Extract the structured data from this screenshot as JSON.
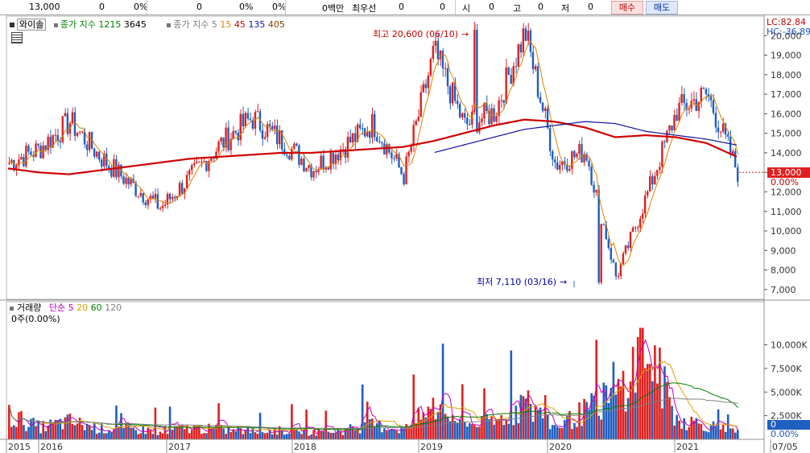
{
  "topbar": {
    "price": "13,000",
    "v1": "0",
    "pct1": "0%",
    "v2": "0",
    "pct2": "0%",
    "pct3": "0%",
    "amount": "0백만",
    "best_label": "최우선",
    "best_v1": "0",
    "best_v2": "0",
    "open_label": "시",
    "open_v": "0",
    "high_label": "고",
    "high_v": "0",
    "low_label": "저",
    "low_v": "0",
    "buy_label": "매수",
    "sell_label": "매도"
  },
  "price_panel": {
    "stock_name": "와이솔",
    "legend1_label": "종가 지수",
    "legend1_values": [
      "1215",
      "3645"
    ],
    "legend2_label": "종가 지수",
    "legend2_values": [
      "5",
      "15",
      "45",
      "135",
      "405"
    ],
    "legend2_colors": [
      "#808080",
      "#e08000",
      "#d00000",
      "#1010a0",
      "#804000"
    ],
    "lc_label": "LC:82.84",
    "hc_label": "HC:-36.89",
    "current_price": "13,000",
    "current_pct": "0.00%",
    "max_annotation": "최고 20,600 (06/10)",
    "min_annotation": "최저 7,110 (03/16)",
    "grid_icon": "grid-icon"
  },
  "volume_panel": {
    "title": "거래량",
    "legend_label": "단순",
    "legend_values": [
      "5",
      "20",
      "60",
      "120"
    ],
    "legend_colors": [
      "#c000c0",
      "#e0a000",
      "#008000",
      "#808080"
    ],
    "info": "0주(0.00%)",
    "current_value": "0",
    "current_pct": "0.00%"
  },
  "colors": {
    "up": "#e02020",
    "down": "#1f5fc0",
    "ma_red": "#d00000",
    "ma_navy": "#1010a0",
    "ma_orange": "#e08000"
  },
  "chart_data": [
    {
      "type": "candlestick",
      "title": "와이솔",
      "x_tick_labels": [
        "2015",
        "2016",
        "2017",
        "2018",
        "2019",
        "2020",
        "2021",
        "07/05"
      ],
      "ylim": [
        6500,
        21000
      ],
      "y_ticks": [
        7000,
        8000,
        9000,
        10000,
        11000,
        12000,
        13000,
        14000,
        15000,
        16000,
        17000,
        18000,
        19000,
        20000
      ],
      "y_tick_labels": [
        "7,000",
        "8,000",
        "9,000",
        "10,000",
        "11,000",
        "12,000",
        "13,000",
        "14,000",
        "15,000",
        "16,000",
        "17,000",
        "18,000",
        "19,000",
        "20,000"
      ],
      "x": [
        "2015-06",
        "2015-09",
        "2015-12",
        "2016-03",
        "2016-06",
        "2016-09",
        "2016-12",
        "2017-03",
        "2017-06",
        "2017-09",
        "2017-12",
        "2018-03",
        "2018-06",
        "2018-09",
        "2018-12",
        "2019-03",
        "2019-06",
        "2019-09",
        "2019-12",
        "2020-03",
        "2020-06",
        "2020-09",
        "2020-12",
        "2021-03",
        "2021-06"
      ],
      "close": [
        13500,
        14200,
        15600,
        13800,
        12400,
        11200,
        12800,
        14500,
        15800,
        14600,
        13200,
        14300,
        15500,
        12800,
        19200,
        15400,
        16100,
        20200,
        13400,
        14100,
        7600,
        11800,
        16200,
        17000,
        13000
      ],
      "max": {
        "value": 20600,
        "date": "06/10"
      },
      "min": {
        "value": 7110,
        "date": "03/16"
      },
      "current": 13000,
      "ma_series": [
        {
          "name": "1215",
          "values": [
            13200,
            13000,
            12900,
            13100,
            13300,
            13500,
            13700,
            13800,
            13900,
            14000,
            14000,
            14100,
            14200,
            14300,
            14600,
            15000,
            15400,
            15700,
            15600,
            15300,
            14800,
            14900,
            14800,
            14500,
            13800
          ]
        },
        {
          "name": "3645",
          "values": [
            null,
            null,
            null,
            null,
            null,
            null,
            null,
            null,
            null,
            null,
            null,
            null,
            null,
            null,
            14000,
            14400,
            14800,
            15200,
            15400,
            15600,
            15500,
            15100,
            14900,
            14700,
            14400
          ]
        }
      ]
    },
    {
      "type": "bar",
      "title": "거래량",
      "ylim": [
        0,
        12000
      ],
      "y_ticks": [
        2500,
        5000,
        7500,
        10000
      ],
      "y_tick_labels": [
        "2,500K",
        "5,000K",
        "7,500K",
        "10,000K"
      ],
      "x": [
        "2015-06",
        "2015-09",
        "2015-12",
        "2016-03",
        "2016-06",
        "2016-09",
        "2016-12",
        "2017-03",
        "2017-06",
        "2017-09",
        "2017-12",
        "2018-03",
        "2018-06",
        "2018-09",
        "2018-12",
        "2019-03",
        "2019-06",
        "2019-09",
        "2019-12",
        "2020-03",
        "2020-06",
        "2020-09",
        "2020-12",
        "2021-03",
        "2021-06"
      ],
      "values": [
        3000,
        1500,
        2200,
        1300,
        1200,
        1100,
        1400,
        1200,
        1000,
        1100,
        900,
        1100,
        1800,
        1200,
        4000,
        2000,
        2100,
        4500,
        1500,
        3500,
        5500,
        11500,
        2500,
        1800,
        800
      ]
    }
  ]
}
